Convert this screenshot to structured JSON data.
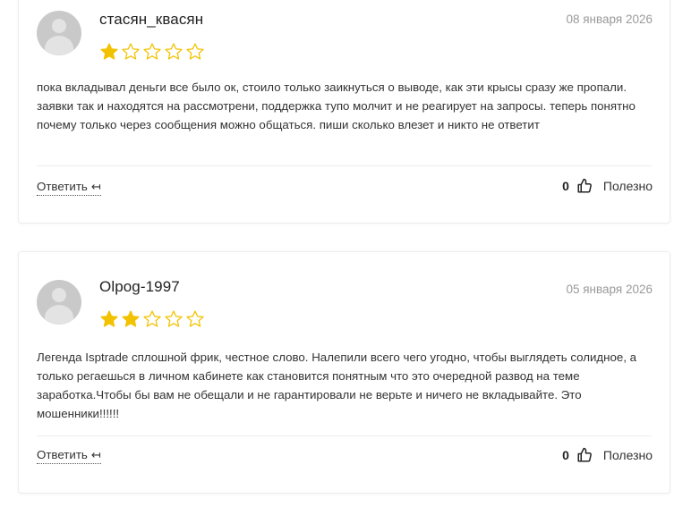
{
  "colors": {
    "star": "#f2c200",
    "date": "#9a9a9a",
    "avatar": "#c9c9c9"
  },
  "reviews": [
    {
      "author": "стасян_квасян",
      "date": "08 января 2026",
      "rating": 1,
      "max_rating": 5,
      "text": "пока вкладывал деньги все было ок, стоило только заикнуться о выводе, как эти крысы сразу же пропали. заявки так и находятся на рассмотрени, поддержка тупо молчит и не реагирует на запросы. теперь понятно почему только через сообщения можно общаться. пиши сколько влезет и никто не ответит",
      "reply_label": "Ответить",
      "reply_arrow": "↤",
      "helpful_count": "0",
      "helpful_label": "Полезно"
    },
    {
      "author": "Olpog-1997",
      "date": "05 января 2026",
      "rating": 2,
      "max_rating": 5,
      "text": "Легенда Isptrade сплошной фрик, честное слово. Налепили всего чего угодно, чтобы выглядеть солидное, а только регаешься в личном кабинете как становится понятным что это очередной развод на теме заработка.Чтобы бы вам не обещали и не гарантировали не верьте и ничего не вкладывайте. Это мошенники!!!!!!",
      "reply_label": "Ответить",
      "reply_arrow": "↤",
      "helpful_count": "0",
      "helpful_label": "Полезно"
    }
  ]
}
